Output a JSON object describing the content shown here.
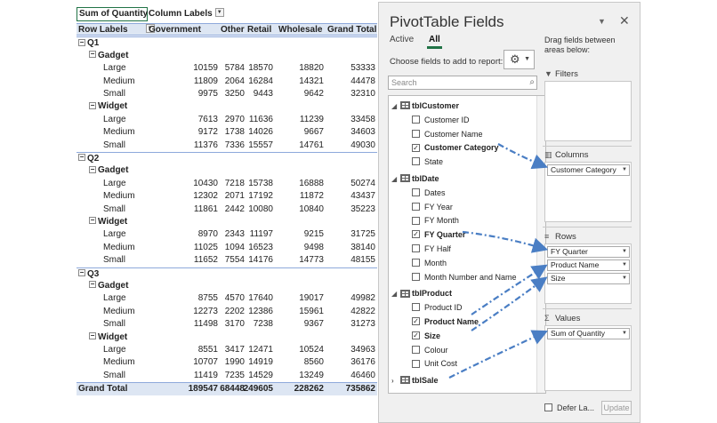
{
  "pivot": {
    "corner_label": "Sum of Quantity",
    "column_labels": "Column Labels",
    "row_labels": "Row Labels",
    "columns": [
      "Government",
      "Other",
      "Retail",
      "Wholesale",
      "Grand Total"
    ],
    "rows": [
      {
        "level": 0,
        "label": "Q1"
      },
      {
        "level": 1,
        "label": "Gadget"
      },
      {
        "level": 2,
        "label": "Large",
        "values": [
          "10159",
          "5784",
          "18570",
          "18820",
          "53333"
        ]
      },
      {
        "level": 2,
        "label": "Medium",
        "values": [
          "11809",
          "2064",
          "16284",
          "14321",
          "44478"
        ]
      },
      {
        "level": 2,
        "label": "Small",
        "values": [
          "9975",
          "3250",
          "9443",
          "9642",
          "32310"
        ]
      },
      {
        "level": 1,
        "label": "Widget"
      },
      {
        "level": 2,
        "label": "Large",
        "values": [
          "7613",
          "2970",
          "11636",
          "11239",
          "33458"
        ]
      },
      {
        "level": 2,
        "label": "Medium",
        "values": [
          "9172",
          "1738",
          "14026",
          "9667",
          "34603"
        ]
      },
      {
        "level": 2,
        "label": "Small",
        "values": [
          "11376",
          "7336",
          "15557",
          "14761",
          "49030"
        ]
      },
      {
        "level": 0,
        "label": "Q2"
      },
      {
        "level": 1,
        "label": "Gadget"
      },
      {
        "level": 2,
        "label": "Large",
        "values": [
          "10430",
          "7218",
          "15738",
          "16888",
          "50274"
        ]
      },
      {
        "level": 2,
        "label": "Medium",
        "values": [
          "12302",
          "2071",
          "17192",
          "11872",
          "43437"
        ]
      },
      {
        "level": 2,
        "label": "Small",
        "values": [
          "11861",
          "2442",
          "10080",
          "10840",
          "35223"
        ]
      },
      {
        "level": 1,
        "label": "Widget"
      },
      {
        "level": 2,
        "label": "Large",
        "values": [
          "8970",
          "2343",
          "11197",
          "9215",
          "31725"
        ]
      },
      {
        "level": 2,
        "label": "Medium",
        "values": [
          "11025",
          "1094",
          "16523",
          "9498",
          "38140"
        ]
      },
      {
        "level": 2,
        "label": "Small",
        "values": [
          "11652",
          "7554",
          "14176",
          "14773",
          "48155"
        ]
      },
      {
        "level": 0,
        "label": "Q3"
      },
      {
        "level": 1,
        "label": "Gadget"
      },
      {
        "level": 2,
        "label": "Large",
        "values": [
          "8755",
          "4570",
          "17640",
          "19017",
          "49982"
        ]
      },
      {
        "level": 2,
        "label": "Medium",
        "values": [
          "12273",
          "2202",
          "12386",
          "15961",
          "42822"
        ]
      },
      {
        "level": 2,
        "label": "Small",
        "values": [
          "11498",
          "3170",
          "7238",
          "9367",
          "31273"
        ]
      },
      {
        "level": 1,
        "label": "Widget"
      },
      {
        "level": 2,
        "label": "Large",
        "values": [
          "8551",
          "3417",
          "12471",
          "10524",
          "34963"
        ]
      },
      {
        "level": 2,
        "label": "Medium",
        "values": [
          "10707",
          "1990",
          "14919",
          "8560",
          "36176"
        ]
      },
      {
        "level": 2,
        "label": "Small",
        "values": [
          "11419",
          "7235",
          "14529",
          "13249",
          "46460"
        ]
      }
    ],
    "grand_total": {
      "label": "Grand Total",
      "values": [
        "189547",
        "68448",
        "249605",
        "228262",
        "735862"
      ]
    }
  },
  "pane": {
    "title": "PivotTable Fields",
    "tabs": [
      "Active",
      "All"
    ],
    "active_tab": "All",
    "choose_label": "Choose fields to add to report:",
    "search_placeholder": "Search",
    "drag_hint": "Drag fields between areas below:",
    "tables": [
      {
        "name": "tblCustomer",
        "expanded": true,
        "fields": [
          {
            "name": "Customer ID",
            "checked": false
          },
          {
            "name": "Customer Name",
            "checked": false
          },
          {
            "name": "Customer Category",
            "checked": true
          },
          {
            "name": "State",
            "checked": false
          }
        ]
      },
      {
        "name": "tblDate",
        "expanded": true,
        "fields": [
          {
            "name": "Dates",
            "checked": false
          },
          {
            "name": "FY Year",
            "checked": false
          },
          {
            "name": "FY Month",
            "checked": false
          },
          {
            "name": "FY Quarter",
            "checked": true
          },
          {
            "name": "FY Half",
            "checked": false
          },
          {
            "name": "Month",
            "checked": false
          },
          {
            "name": "Month Number and Name",
            "checked": false
          }
        ]
      },
      {
        "name": "tblProduct",
        "expanded": true,
        "fields": [
          {
            "name": "Product ID",
            "checked": false
          },
          {
            "name": "Product Name",
            "checked": true
          },
          {
            "name": "Size",
            "checked": true
          },
          {
            "name": "Colour",
            "checked": false
          },
          {
            "name": "Unit Cost",
            "checked": false
          }
        ]
      },
      {
        "name": "tblSale",
        "expanded": false,
        "fields": []
      }
    ],
    "areas": {
      "filters": {
        "label": "Filters",
        "items": []
      },
      "columns": {
        "label": "Columns",
        "items": [
          "Customer Category"
        ]
      },
      "rows": {
        "label": "Rows",
        "items": [
          "FY Quarter",
          "Product Name",
          "Size"
        ]
      },
      "values": {
        "label": "Values",
        "items": [
          "Sum of Quantity"
        ]
      }
    },
    "defer_label": "Defer La...",
    "update_label": "Update"
  },
  "colors": {
    "accent": "#217346",
    "pivot_header": "#dde6f3",
    "arrow": "#4a7ec4"
  }
}
